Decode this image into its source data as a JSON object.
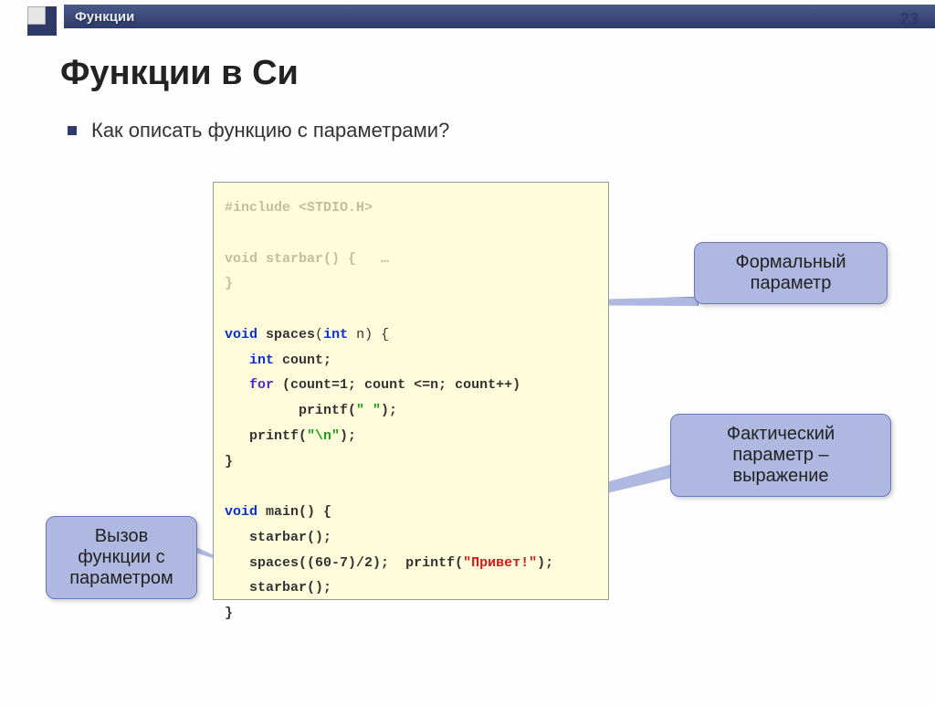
{
  "header": {
    "breadcrumb": "Функции",
    "page_number": "23"
  },
  "title": "Функции в Си",
  "question": "Как описать функцию с параметрами?",
  "code": {
    "include_line": "#include <STDIO.H>",
    "starbar_sig": "void starbar() {",
    "starbar_body": "…",
    "starbar_close": "}",
    "spaces_void": "void",
    "spaces_name": "spaces",
    "spaces_params_open": "(",
    "spaces_int": "int",
    "spaces_n": "n) {",
    "count_decl": "int count;",
    "for_kw": "for",
    "for_body": "(count=1; count <=n; count++)",
    "printf1": "printf(",
    "space_str": "\" \"",
    "printf1_close": ");",
    "printf2": "printf(",
    "nl_str": "\"\\n\"",
    "printf2_close": ");",
    "spaces_close": "}",
    "main_void": "void",
    "main_name": "main",
    "main_sig": "() {",
    "call1": "starbar();",
    "call2a": "spaces((60-7)/2);",
    "call2b_printf": "printf(",
    "call2b_str": "\"Привет!\"",
    "call2b_close": ");",
    "call3": "starbar();",
    "main_close": "}"
  },
  "callouts": {
    "formal": "Формальный параметр",
    "actual": "Фактический параметр – выражение",
    "call": "Вызов функции с параметром"
  }
}
